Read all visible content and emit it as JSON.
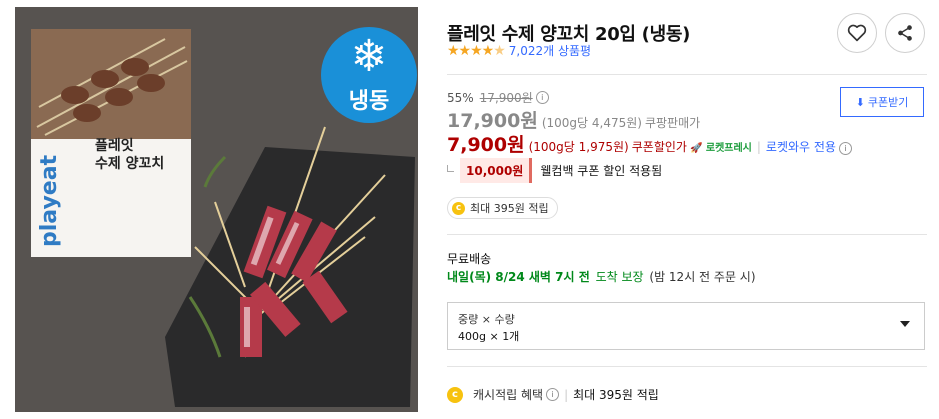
{
  "image": {
    "frozen_badge": "냉동",
    "box_brand": "playeat",
    "box_title_line1": "플레잇",
    "box_title_line2": "수제 양꼬치"
  },
  "product": {
    "title": "플레잇 수제 양꼬치 20입 (냉동)",
    "rating": 4.5,
    "review_count": "7,022개 상품평"
  },
  "price": {
    "discount_rate": "55%",
    "original_price": "17,900원",
    "sale_price": "17,900원",
    "sale_unit_price": "(100g당 4,475원)",
    "sale_label": "쿠팡판매가",
    "coupon_price": "7,900원",
    "coupon_unit_price": "(100g당 1,975원)",
    "coupon_label": "쿠폰할인가",
    "rocket_label": "로켓프레시",
    "wow_label": "로켓와우 전용",
    "coupon_button": "쿠폰받기",
    "welcome_amount": "10,000원",
    "welcome_text": "웰컴백 쿠폰 할인 적용됨",
    "cash_reward": "최대 395원 적립"
  },
  "delivery": {
    "label": "무료배송",
    "date": "내일(목) 8/24 새벽 7시 전",
    "suffix": "도착 보장",
    "note": "(밤 12시 전 주문 시)"
  },
  "option": {
    "label": "중량 × 수량",
    "value": "400g × 1개"
  },
  "cash_benefit": {
    "label": "캐시적립 혜택",
    "amount": "최대 395원 적립"
  },
  "colors": {
    "accent_blue": "#346aff",
    "coupon_red": "#ae0000",
    "delivery_green": "#00891a",
    "coin_yellow": "#f7c20f"
  },
  "icons": {
    "wish": "heart-icon",
    "share": "share-icon",
    "coupon_download": "download-icon",
    "coin": "coin-icon",
    "info": "info-icon",
    "frozen": "snowflake-icon"
  }
}
